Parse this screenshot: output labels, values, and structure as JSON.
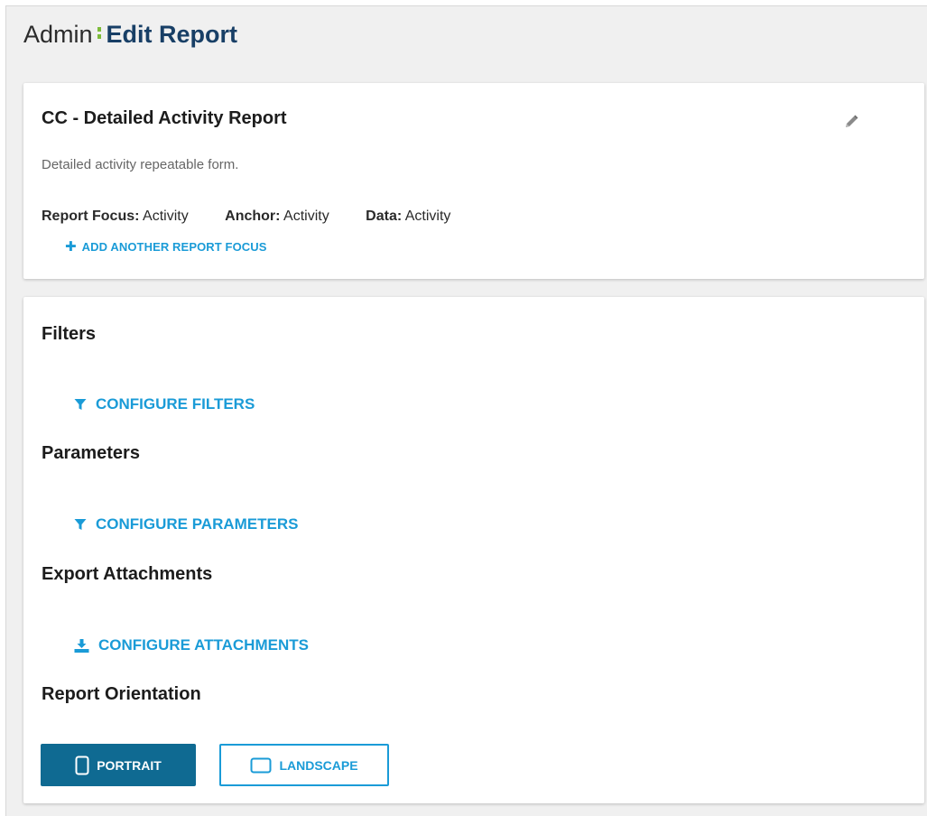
{
  "header": {
    "breadcrumb_root": "Admin",
    "page_title": "Edit Report"
  },
  "report": {
    "name": "CC - Detailed Activity Report",
    "description": "Detailed activity repeatable form.",
    "meta": [
      {
        "label": "Report Focus:",
        "value": "Activity"
      },
      {
        "label": "Anchor:",
        "value": "Activity"
      },
      {
        "label": "Data:",
        "value": "Activity"
      }
    ],
    "add_focus_label": "ADD ANOTHER REPORT FOCUS",
    "edit_icon": "pencil-icon"
  },
  "sections": {
    "filters": {
      "title": "Filters",
      "action_label": "CONFIGURE FILTERS",
      "icon": "filter-icon"
    },
    "parameters": {
      "title": "Parameters",
      "action_label": "CONFIGURE PARAMETERS",
      "icon": "filter-icon"
    },
    "attachments": {
      "title": "Export Attachments",
      "action_label": "CONFIGURE ATTACHMENTS",
      "icon": "download-icon"
    },
    "orientation": {
      "title": "Report Orientation",
      "portrait_label": "PORTRAIT",
      "landscape_label": "LANDSCAPE",
      "selected": "PORTRAIT"
    }
  },
  "colors": {
    "accent": "#1a9bd7",
    "primary_button": "#0f6a92",
    "title_navy": "#183f66",
    "breadcrumb_separator": "#7dbb3a"
  }
}
